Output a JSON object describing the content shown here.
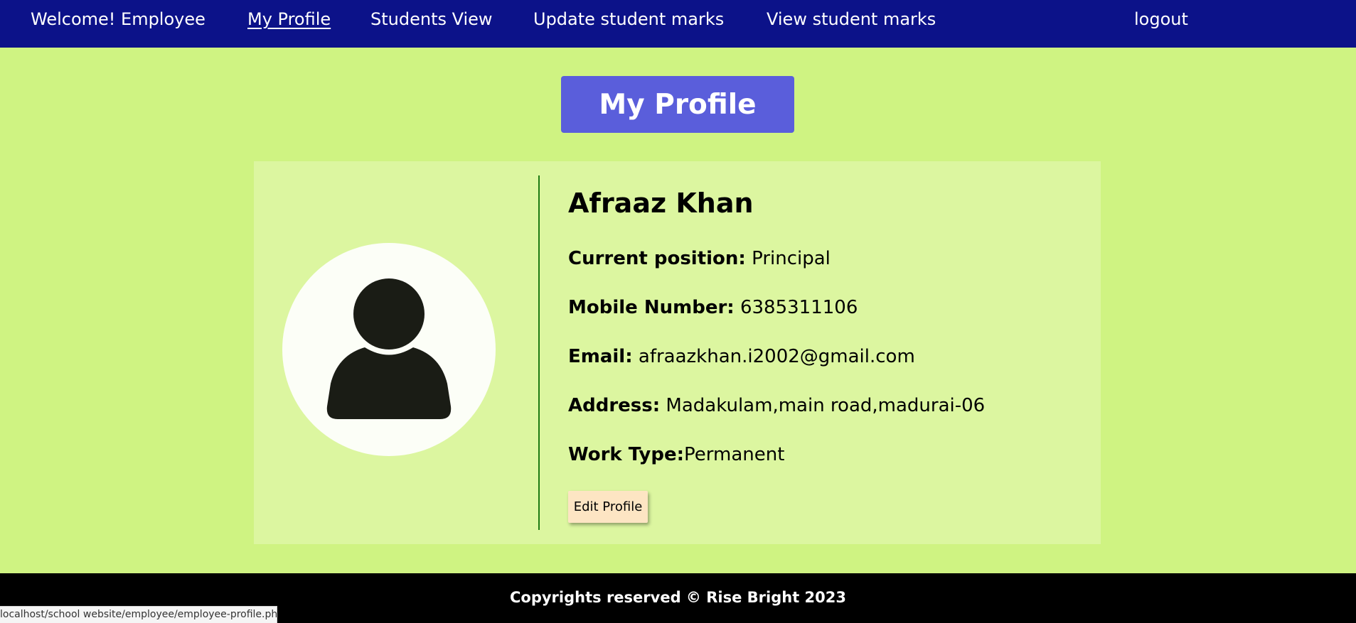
{
  "nav": {
    "welcome": "Welcome! Employee",
    "items": [
      {
        "label": "My Profile",
        "active": true
      },
      {
        "label": "Students View",
        "active": false
      },
      {
        "label": "Update student marks",
        "active": false
      },
      {
        "label": "View student marks",
        "active": false
      }
    ],
    "logout": "logout"
  },
  "page_title": "My Profile",
  "profile": {
    "name": "Afraaz Khan",
    "position_label": "Current position:",
    "position_value": " Principal",
    "mobile_label": "Mobile Number:",
    "mobile_value": " 6385311106",
    "email_label": "Email:",
    "email_value": " afraazkhan.i2002@gmail.com",
    "address_label": "Address:",
    "address_value": " Madakulam,main road,madurai-06",
    "work_label": "Work Type:",
    "work_value": "Permanent",
    "avatar_icon": "user-silhouette-icon"
  },
  "edit_button": "Edit Profile",
  "footer": "Copyrights reserved © Rise Bright 2023",
  "status_bar_url": "localhost/school website/employee/employee-profile.php",
  "colors": {
    "nav_bg": "#0c1289",
    "page_bg": "#cff382",
    "card_bg": "#dcf6a0",
    "title_bg": "#5a5edb",
    "divider": "#1d7a13",
    "button_bg": "#fde5c3",
    "footer_bg": "#000000"
  }
}
